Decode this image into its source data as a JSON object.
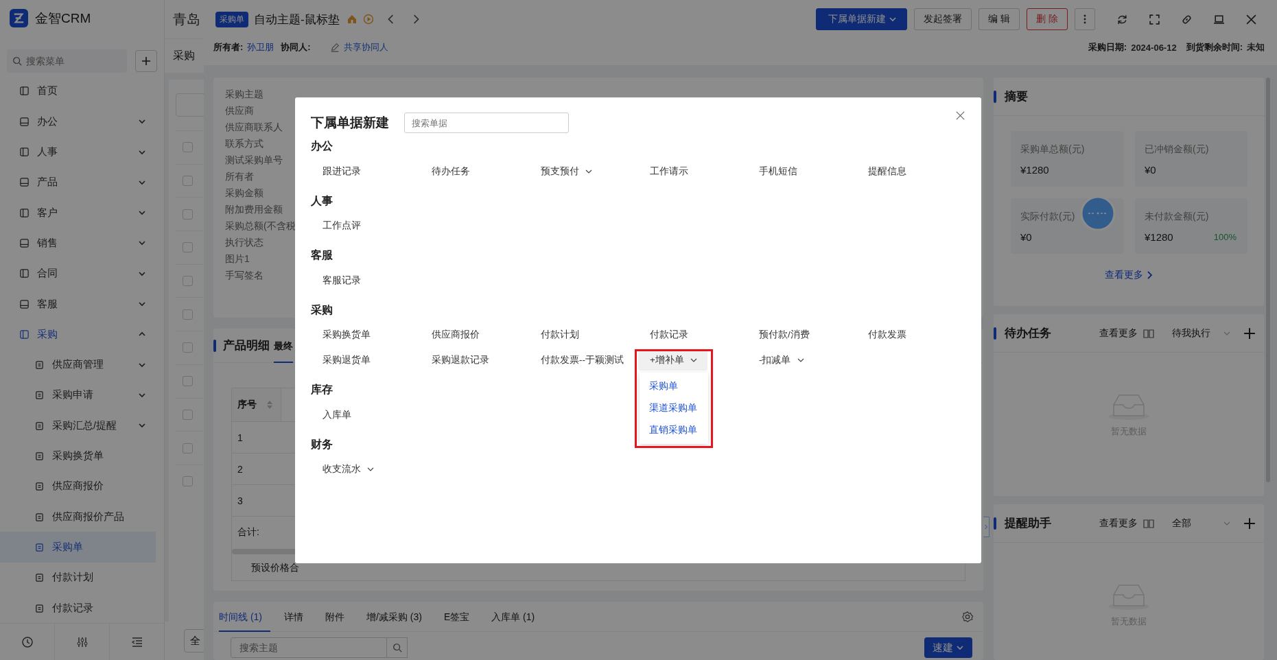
{
  "sidebar": {
    "logo": "金智CRM",
    "search": {
      "placeholder": "搜索菜单"
    },
    "items": [
      {
        "label": "首页",
        "selected": false
      },
      {
        "label": "办公",
        "expanded": false,
        "selected": false
      },
      {
        "label": "人事",
        "expanded": false,
        "selected": false
      },
      {
        "label": "产品",
        "expanded": false,
        "selected": false
      },
      {
        "label": "客户",
        "expanded": false,
        "selected": false
      },
      {
        "label": "销售",
        "expanded": false,
        "selected": false
      },
      {
        "label": "合同",
        "expanded": false,
        "selected": false
      },
      {
        "label": "客服",
        "expanded": false,
        "selected": false
      },
      {
        "label": "采购",
        "expanded": true,
        "selected": false,
        "children": [
          {
            "label": "供应商管理",
            "expanded": false,
            "selected": false
          },
          {
            "label": "采购申请",
            "expanded": false,
            "selected": false
          },
          {
            "label": "采购汇总/提醒",
            "expanded": false,
            "selected": false
          },
          {
            "label": "采购换货单",
            "selected": false
          },
          {
            "label": "供应商报价",
            "selected": false
          },
          {
            "label": "供应商报价产品",
            "selected": false
          },
          {
            "label": "采购单",
            "selected": true
          },
          {
            "label": "付款计划",
            "selected": false
          },
          {
            "label": "付款记录",
            "selected": false
          }
        ]
      }
    ]
  },
  "background_page": {
    "title": "青岛",
    "heading": "采购",
    "rows": [
      {
        "checked": false
      },
      {
        "checked": false
      },
      {
        "checked": false
      },
      {
        "checked": false
      },
      {
        "checked": false
      },
      {
        "checked": false
      },
      {
        "checked": false
      },
      {
        "checked": false
      },
      {
        "checked": false
      },
      {
        "checked": false
      },
      {
        "checked": false
      }
    ],
    "footer_button": "全"
  },
  "drawer": {
    "badge": "采购单",
    "title": "自动主题-鼠标垫",
    "actions": [
      {
        "label": "下属单据新建",
        "kind": "primary"
      },
      {
        "label": "发起签署",
        "kind": "default"
      },
      {
        "label": "编 辑",
        "kind": "default"
      },
      {
        "label": "删 除",
        "kind": "danger"
      }
    ],
    "owner": {
      "label": "所有者:",
      "value": "孙卫朋"
    },
    "collaborator": {
      "label": "协同人:",
      "link": "共享协同人"
    },
    "dates": [
      {
        "label": "采购日期:",
        "value": "2024-06-12"
      },
      {
        "label": "到货剩余时间:",
        "value": "未知"
      }
    ],
    "info_labels": [
      "采购主题",
      "供应商",
      "供应商联系人",
      "联系方式",
      "测试采购单号",
      "所有者",
      "采购金额",
      "附加费用金额",
      "采购总额(不含税",
      "执行状态",
      "图片1",
      "手写签名"
    ],
    "products": {
      "title": "产品明细",
      "tabs": [
        {
          "label": "最终",
          "selected": true
        }
      ],
      "column": "序号",
      "rows": [
        "1",
        "2",
        "3"
      ],
      "total_label": "合计:",
      "footer": "预设价格合"
    },
    "bottom_tabs": [
      {
        "label": "时间线 (1)",
        "selected": true
      },
      {
        "label": "详情",
        "selected": false
      },
      {
        "label": "附件",
        "selected": false
      },
      {
        "label": "增/减采购 (3)",
        "selected": false
      },
      {
        "label": "E签宝",
        "selected": false
      },
      {
        "label": "入库单 (1)",
        "selected": false
      }
    ],
    "timeline_search": {
      "placeholder": "搜索主题"
    },
    "quick_button": "速建",
    "summary": {
      "title": "摘要",
      "stats": [
        {
          "label": "采购单总额(元)",
          "value": "¥1280"
        },
        {
          "label": "已冲销金额(元)",
          "value": "¥0"
        },
        {
          "label": "实际付款(元)",
          "value": "¥0"
        },
        {
          "label": "未付款金额(元)",
          "value": "¥1280",
          "percent": "100%"
        }
      ],
      "more": "查看更多"
    },
    "panels": [
      {
        "title": "待办任务",
        "more": "查看更多",
        "filter": "待我执行",
        "empty": "暂无数据"
      },
      {
        "title": "提醒助手",
        "more": "查看更多",
        "filter": "全部",
        "empty": "暂无数据"
      }
    ]
  },
  "modal": {
    "title": "下属单据新建",
    "search": {
      "placeholder": "搜索单据"
    },
    "sections": [
      {
        "title": "办公",
        "items": [
          {
            "label": "跟进记录"
          },
          {
            "label": "待办任务"
          },
          {
            "label": "预支预付",
            "expanded": false
          },
          {
            "label": "工作请示"
          },
          {
            "label": "手机短信"
          },
          {
            "label": "提醒信息"
          }
        ]
      },
      {
        "title": "人事",
        "items": [
          {
            "label": "工作点评"
          }
        ]
      },
      {
        "title": "客服",
        "items": [
          {
            "label": "客服记录"
          }
        ]
      },
      {
        "title": "采购",
        "items": [
          {
            "label": "采购换货单"
          },
          {
            "label": "供应商报价"
          },
          {
            "label": "付款计划"
          },
          {
            "label": "付款记录"
          },
          {
            "label": "预付款/消费"
          },
          {
            "label": "付款发票"
          },
          {
            "label": "采购退货单"
          },
          {
            "label": "采购退款记录"
          },
          {
            "label": "付款发票--于颖测试"
          },
          {
            "label": "+增补单",
            "expanded": true,
            "highlighted": true,
            "options": [
              "采购单",
              "渠道采购单",
              "直销采购单"
            ]
          },
          {
            "label": "-扣减单",
            "expanded": false
          }
        ]
      },
      {
        "title": "库存",
        "items": [
          {
            "label": "入库单"
          }
        ]
      },
      {
        "title": "财务",
        "items": [
          {
            "label": "收支流水",
            "expanded": false
          }
        ]
      }
    ]
  }
}
